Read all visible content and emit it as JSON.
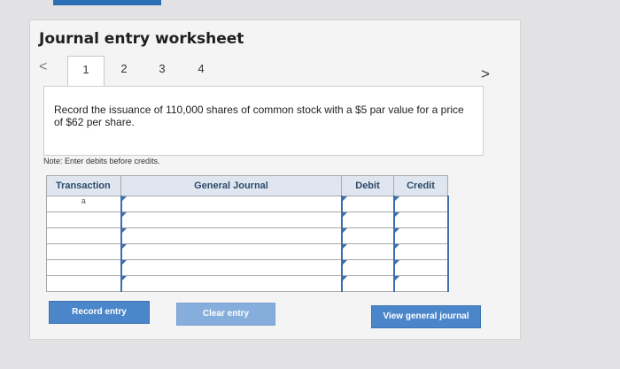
{
  "header": {
    "title": "Journal entry worksheet"
  },
  "nav": {
    "prev_glyph": "<",
    "next_glyph": ">",
    "tabs": [
      {
        "label": "1"
      },
      {
        "label": "2"
      },
      {
        "label": "3"
      },
      {
        "label": "4"
      }
    ],
    "active_tab": "1"
  },
  "prompt": {
    "text": "Record the issuance of 110,000 shares of common stock with a $5 par value for a price of $62 per share."
  },
  "note": "Note: Enter debits before credits.",
  "table": {
    "columns": {
      "transaction": "Transaction",
      "account": "General Journal",
      "debit": "Debit",
      "credit": "Credit"
    },
    "rows": [
      {
        "transaction": "a",
        "account": "",
        "debit": "",
        "credit": ""
      },
      {
        "transaction": "",
        "account": "",
        "debit": "",
        "credit": ""
      },
      {
        "transaction": "",
        "account": "",
        "debit": "",
        "credit": ""
      },
      {
        "transaction": "",
        "account": "",
        "debit": "",
        "credit": ""
      },
      {
        "transaction": "",
        "account": "",
        "debit": "",
        "credit": ""
      },
      {
        "transaction": "",
        "account": "",
        "debit": "",
        "credit": ""
      }
    ]
  },
  "buttons": {
    "record": "Record entry",
    "clear": "Clear entry",
    "view": "View general journal"
  },
  "colors": {
    "accent": "#4a86c9",
    "header_bg": "#dfe6ef"
  }
}
